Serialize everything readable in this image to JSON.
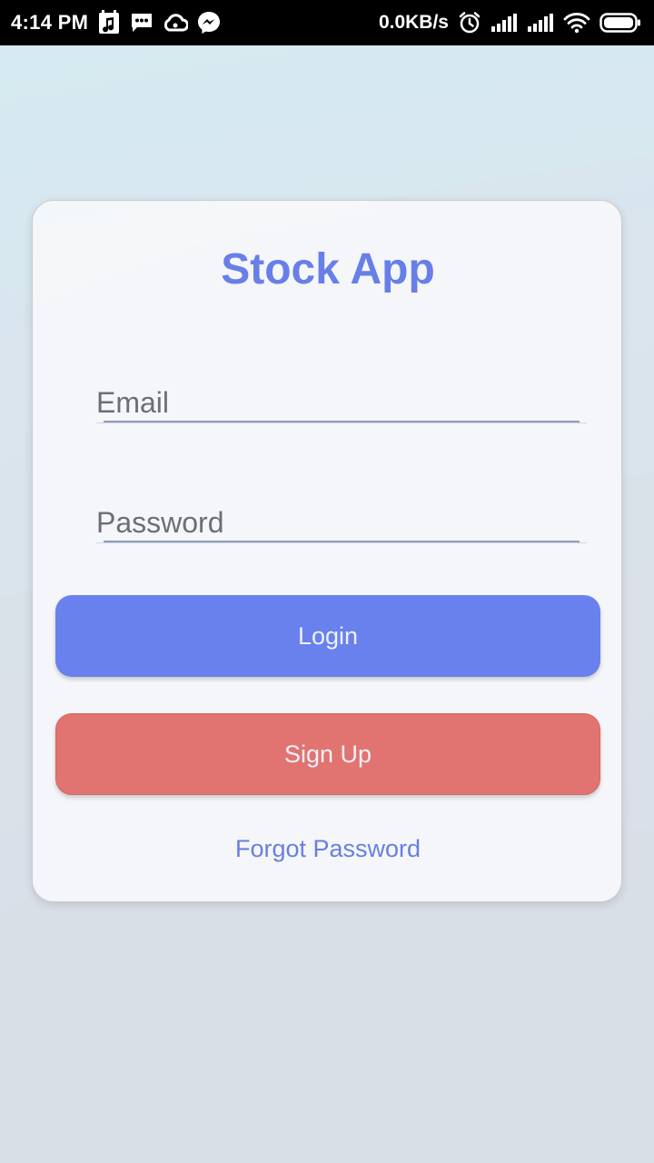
{
  "status_bar": {
    "time": "4:14 PM",
    "network_speed": "0.0KB/s",
    "left_icons": [
      "music-notification-icon",
      "message-icon",
      "cloud-icon",
      "messenger-icon"
    ],
    "right_icons": [
      "alarm-icon",
      "signal-icon",
      "signal-icon",
      "wifi-icon",
      "battery-icon"
    ]
  },
  "login_card": {
    "title": "Stock App",
    "email_field": {
      "label": "Email",
      "value": ""
    },
    "password_field": {
      "label": "Password",
      "value": ""
    },
    "login_button": "Login",
    "signup_button": "Sign Up",
    "forgot_password_link": "Forgot Password"
  },
  "colors": {
    "accent": "#687FE9",
    "login_button": "#6881EC",
    "signup_button": "#E17470",
    "status_bar": "#000000"
  }
}
